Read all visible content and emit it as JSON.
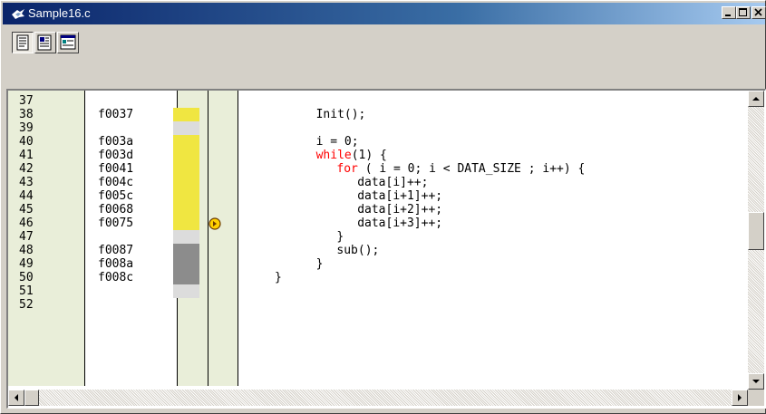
{
  "window": {
    "title": "Sample16.c"
  },
  "toolbar": {
    "buttons": [
      {
        "icon": "source-view-icon",
        "pressed": true
      },
      {
        "icon": "mixed-view-icon",
        "pressed": false
      },
      {
        "icon": "disassembly-view-icon",
        "pressed": false
      }
    ]
  },
  "editor": {
    "rows": [
      {
        "line": "37",
        "addr": "",
        "coverage": "none",
        "code": ""
      },
      {
        "line": "38",
        "addr": "f0037",
        "coverage": "yellow",
        "code": "Init();"
      },
      {
        "line": "39",
        "addr": "",
        "coverage": "none",
        "code": ""
      },
      {
        "line": "40",
        "addr": "f003a",
        "coverage": "yellow",
        "code": "i = 0;"
      },
      {
        "line": "41",
        "addr": "f003d",
        "coverage": "yellow",
        "kw": "while",
        "code": "(1) {"
      },
      {
        "line": "42",
        "addr": "f0041",
        "coverage": "yellow",
        "kw": "for",
        "code": " ( i = 0; i < DATA_SIZE ; i++) {"
      },
      {
        "line": "43",
        "addr": "f004c",
        "coverage": "yellow",
        "code": "data[i]++;"
      },
      {
        "line": "44",
        "addr": "f005c",
        "coverage": "yellow",
        "code": "data[i+1]++;"
      },
      {
        "line": "45",
        "addr": "f0068",
        "coverage": "yellow",
        "code": "data[i+2]++;"
      },
      {
        "line": "46",
        "addr": "f0075",
        "coverage": "yellow",
        "code": "data[i+3]++;",
        "pc_marker": true
      },
      {
        "line": "47",
        "addr": "",
        "coverage": "none",
        "code": "}"
      },
      {
        "line": "48",
        "addr": "f0087",
        "coverage": "gray",
        "code": "sub();"
      },
      {
        "line": "49",
        "addr": "f008a",
        "coverage": "gray",
        "code": "}"
      },
      {
        "line": "50",
        "addr": "f008c",
        "coverage": "gray",
        "code": "}"
      },
      {
        "line": "51",
        "addr": "",
        "coverage": "none",
        "code": ""
      },
      {
        "line": "52",
        "addr": "",
        "coverage": "none",
        "code": ""
      }
    ]
  },
  "colors": {
    "coverage_yellow": "#f0e641",
    "coverage_gray": "#8c8c8c",
    "coverage_none": "#e9eed9",
    "keyword": "#ff0000",
    "pc_marker": "#ffd000"
  }
}
